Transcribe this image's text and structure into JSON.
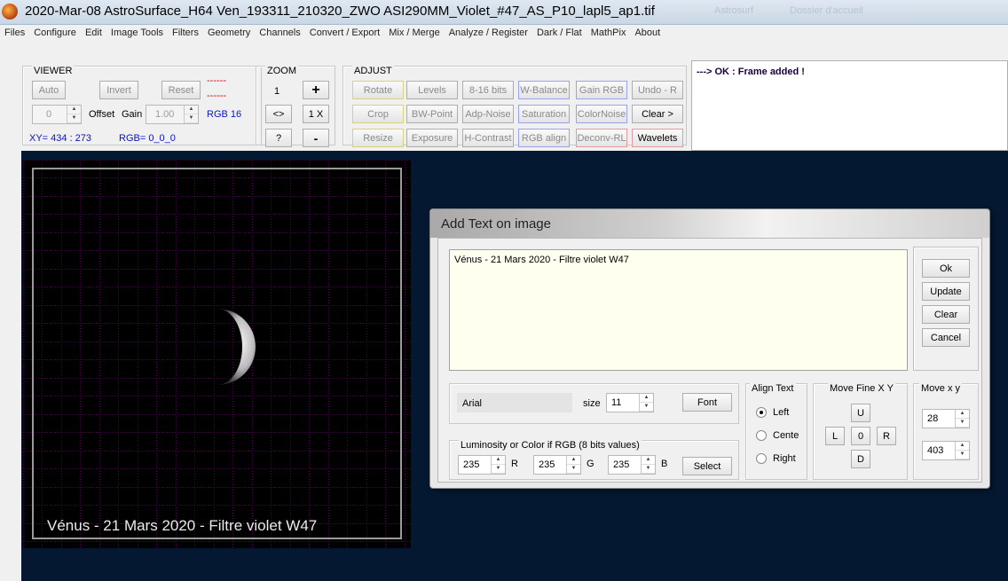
{
  "window": {
    "title": "2020-Mar-08  AstroSurface_H64    Ven_193311_210320_ZWO ASI290MM_Violet_#47_AS_P10_lapl5_ap1.tif",
    "ghost1": "Astrosurf",
    "ghost2": "Dossier d'accueil"
  },
  "menu": [
    "Files",
    "Configure",
    "Edit",
    "Image Tools",
    "Filters",
    "Geometry",
    "Channels",
    "Convert / Export",
    "Mix / Merge",
    "Analyze / Register",
    "Dark / Flat",
    "MathPix",
    "About"
  ],
  "viewer": {
    "label": "VIEWER",
    "auto": "Auto",
    "invert": "Invert",
    "reset": "Reset",
    "dash1": "------",
    "dash2": "------",
    "offset_value": "0",
    "offset_label": "Offset",
    "gain_label": "Gain",
    "gain_value": "1.00",
    "rgb16": "RGB 16",
    "xy": "XY=  434 : 273",
    "rgb": "RGB=  0_0_0"
  },
  "zoom": {
    "label": "ZOOM",
    "level": "1",
    "plus": "+",
    "fit": "<>",
    "onex": "1 X",
    "help": "?",
    "minus": "-"
  },
  "adjust": {
    "label": "ADJUST",
    "buttons": [
      "Rotate",
      "Levels",
      "8-16 bits",
      "W-Balance",
      "Gain RGB",
      "Undo - R",
      "Crop",
      "BW-Point",
      "Adp-Noise",
      "Saturation",
      "ColorNoise",
      "Clear >",
      "Resize",
      "Exposure",
      "H-Contrast",
      "RGB align",
      "Deconv-RL",
      "Wavelets"
    ]
  },
  "message": "---> OK :  Frame added !",
  "image": {
    "caption": "Vénus - 21 Mars 2020 - Filtre violet W47"
  },
  "dialog": {
    "title": "Add Text on image",
    "text": "Vénus - 21 Mars 2020 - Filtre violet W47",
    "ok": "Ok",
    "update": "Update",
    "clear": "Clear",
    "cancel": "Cancel",
    "font_name": "Arial",
    "size_label": "size",
    "size_value": "11",
    "font_button": "Font",
    "lum_label": "Luminosity or Color if RGB  (8 bits values)",
    "r_value": "235",
    "r_label": "R",
    "g_value": "235",
    "g_label": "G",
    "b_value": "235",
    "b_label": "B",
    "select": "Select",
    "align_label": "Align Text",
    "align_left": "Left",
    "align_center": "Center",
    "align_right": "Right",
    "movefine_label": "Move Fine  X  Y",
    "up": "U",
    "left": "L",
    "zero": "0",
    "right": "R",
    "down": "D",
    "move_label": "Move  x  y",
    "move_x": "28",
    "move_y": "403"
  },
  "colors": {
    "workspace": "#041931",
    "grid": "#b000b8",
    "message_text": "#1a0040"
  }
}
